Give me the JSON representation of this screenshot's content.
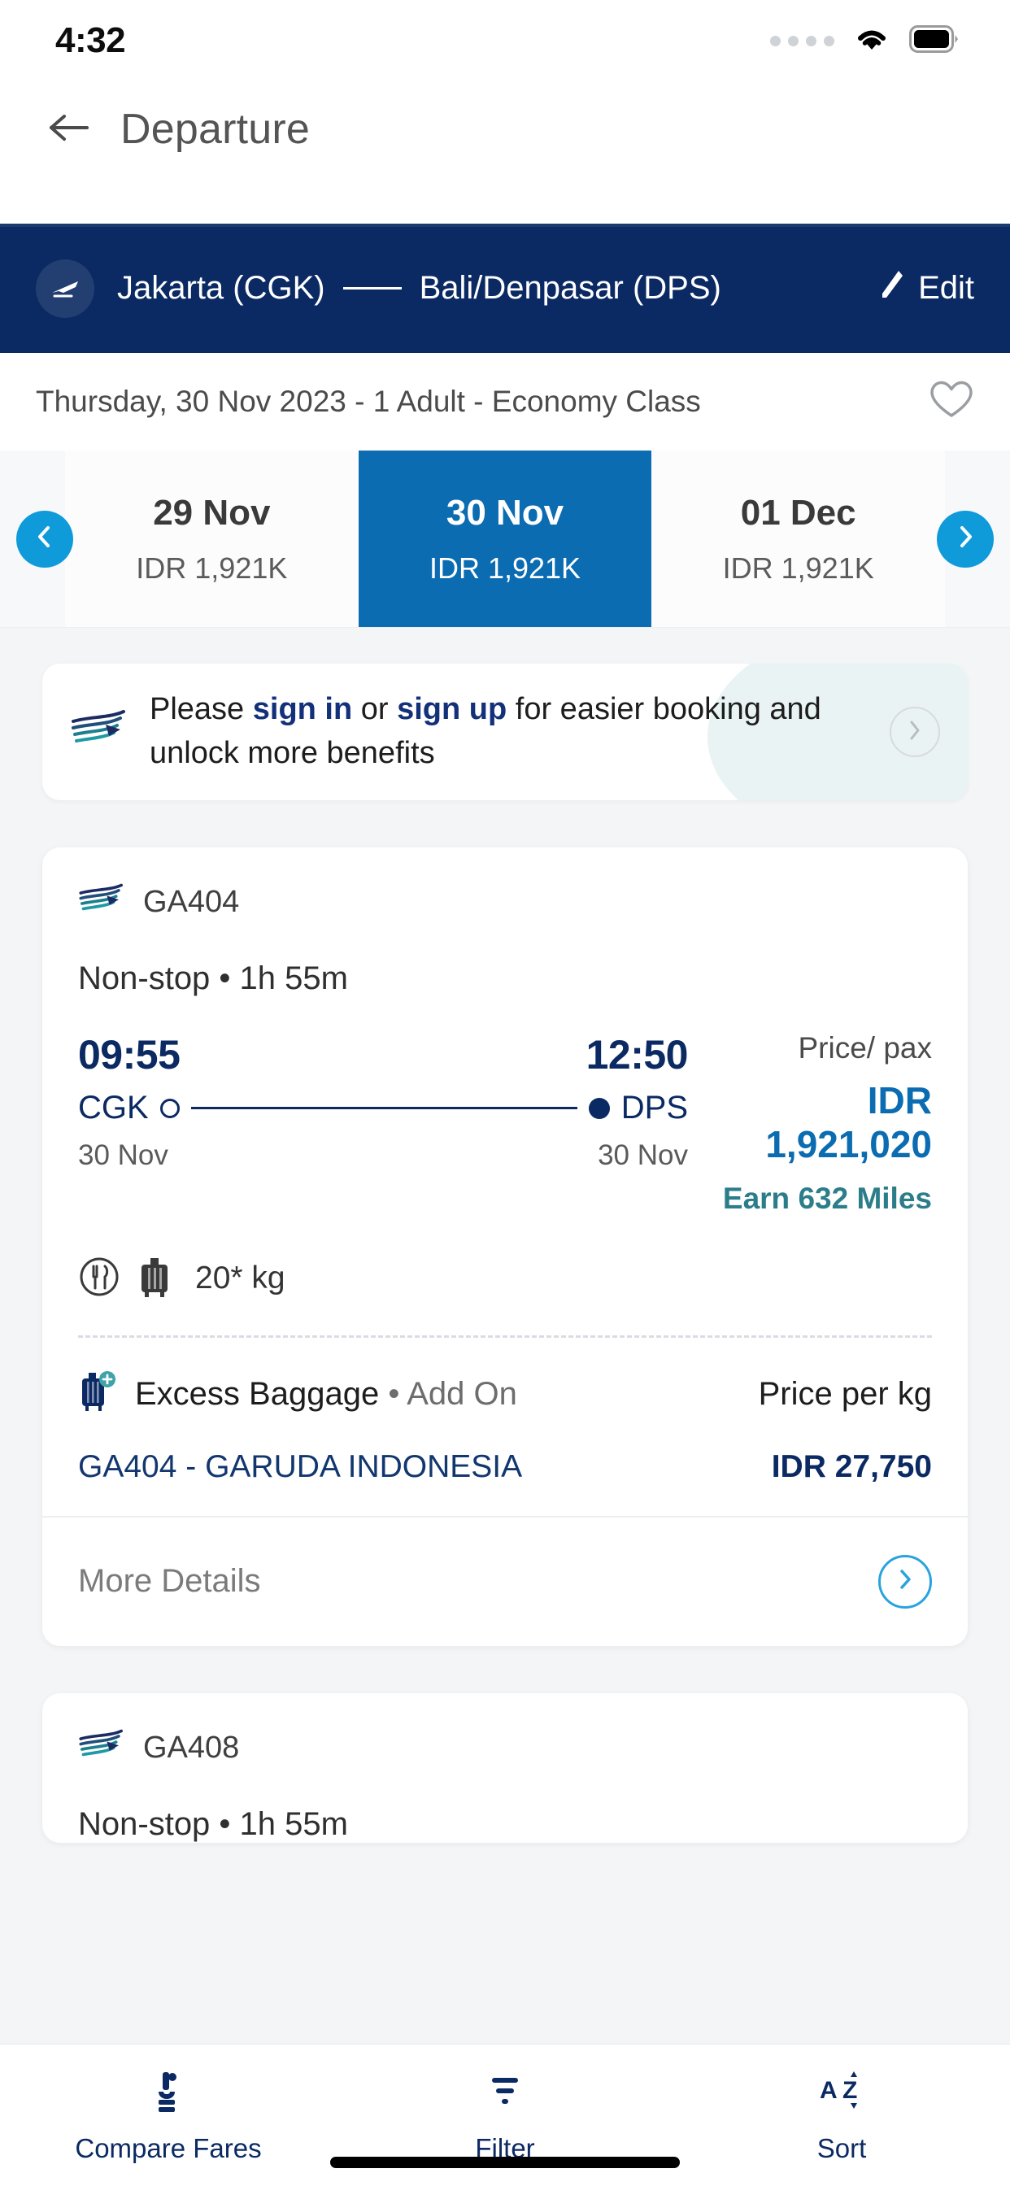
{
  "status_bar": {
    "time": "4:32",
    "signal_icon": "signal-dots-icon",
    "wifi_icon": "wifi-icon",
    "battery_icon": "battery-full-icon"
  },
  "app_bar": {
    "back_icon": "arrow-left-icon",
    "title": "Departure"
  },
  "route_bar": {
    "plane_icon": "airplane-icon",
    "origin": "Jakarta (CGK)",
    "destination": "Bali/Denpasar (DPS)",
    "edit_icon": "pencil-icon",
    "edit_label": "Edit",
    "background_color": "#0b2a63"
  },
  "info_row": {
    "summary": "Thursday, 30 Nov 2023 - 1 Adult - Economy Class",
    "favorite_icon": "heart-outline-icon"
  },
  "date_carousel": {
    "prev_icon": "chevron-left-icon",
    "next_icon": "chevron-right-icon",
    "selected_index": 1,
    "selected_color": "#0b6cb2",
    "arrow_color": "#0f9ada",
    "dates": [
      {
        "date": "29 Nov",
        "price": "IDR 1,921K",
        "selected": false
      },
      {
        "date": "30 Nov",
        "price": "IDR 1,921K",
        "selected": true
      },
      {
        "date": "01 Dec",
        "price": "IDR 1,921K",
        "selected": false
      }
    ]
  },
  "signin_banner": {
    "logo_icon": "garuda-logo-icon",
    "text_prefix": "Please ",
    "sign_in": "sign in",
    "text_middle": " or ",
    "sign_up": "sign up",
    "text_suffix": " for easier booking and unlock more benefits",
    "chevron_icon": "chevron-right-icon",
    "link_color": "#13307a"
  },
  "flights": [
    {
      "logo_icon": "garuda-logo-icon",
      "flight_code": "GA404",
      "stops_duration": "Non-stop • 1h 55m",
      "depart_time": "09:55",
      "arrive_time": "12:50",
      "depart_airport": "CGK",
      "arrive_airport": "DPS",
      "depart_date": "30 Nov",
      "arrive_date": "30 Nov",
      "price_label": "Price/ pax",
      "currency": "IDR",
      "amount": "1,921,020",
      "miles": "Earn 632 Miles",
      "meal_icon": "meal-icon",
      "baggage_icon": "suitcase-icon",
      "baggage_allowance": "20* kg",
      "excess_icon": "excess-baggage-icon",
      "excess_label": "Excess Baggage",
      "excess_addon": " • Add On",
      "excess_right_label": "Price per kg",
      "excess_airline": "GA404 - GARUDA INDONESIA",
      "excess_price": "IDR 27,750",
      "more_details_label": "More Details",
      "more_details_icon": "chevron-right-circle-icon"
    },
    {
      "logo_icon": "garuda-logo-icon",
      "flight_code": "GA408",
      "stops_duration": "Non-stop • 1h 55m"
    }
  ],
  "bottom_nav": {
    "items": [
      {
        "icon": "compare-fares-icon",
        "label": "Compare Fares"
      },
      {
        "icon": "filter-icon",
        "label": "Filter"
      },
      {
        "icon": "sort-az-icon",
        "label": "Sort"
      }
    ],
    "color": "#0b2a63"
  }
}
